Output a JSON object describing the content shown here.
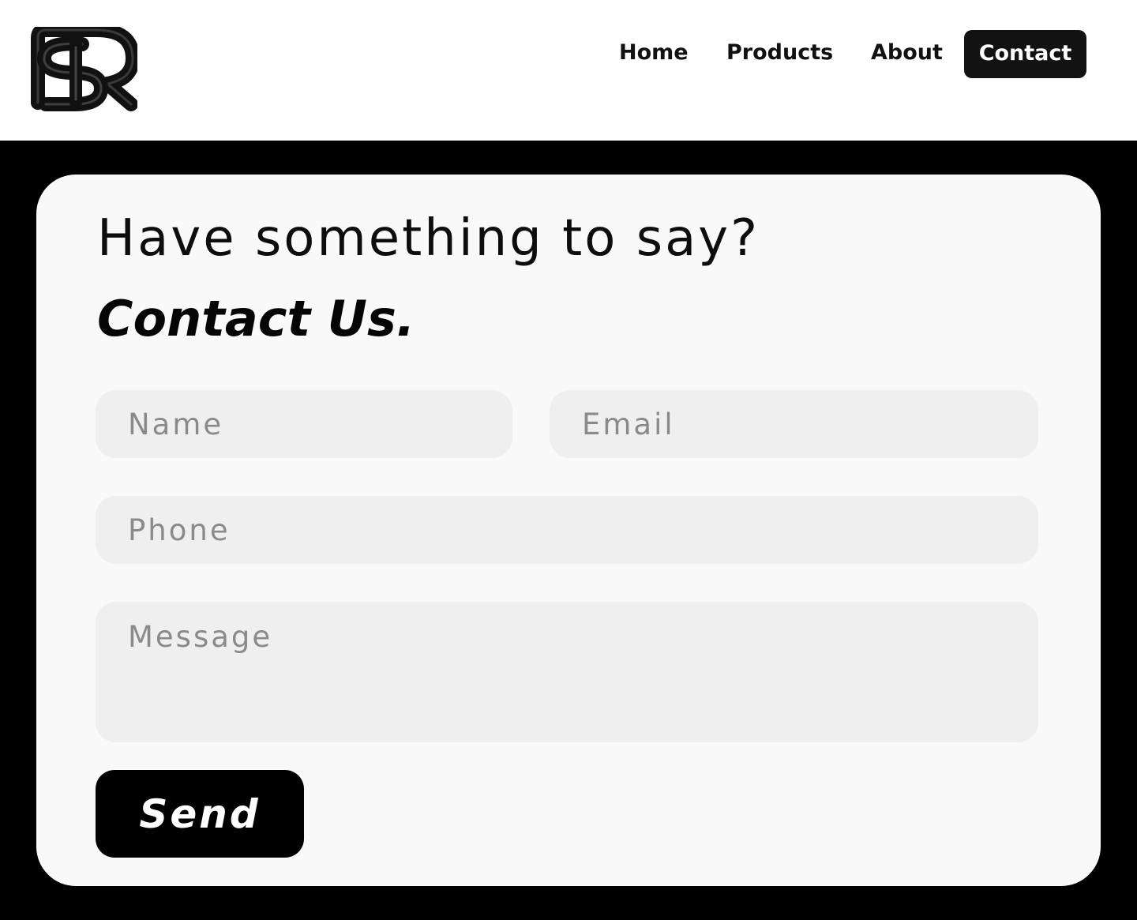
{
  "header": {
    "logo_icon": "sr-monogram-logo-icon",
    "nav": {
      "home_label": "Home",
      "products_label": "Products",
      "about_label": "About",
      "contact_label": "Contact",
      "active": "Contact"
    }
  },
  "main": {
    "heading_line1": "Have something to say?",
    "heading_line2": "Contact Us.",
    "form": {
      "name_placeholder": "Name",
      "email_placeholder": "Email",
      "phone_placeholder": "Phone",
      "message_placeholder": "Message",
      "send_label": "Send"
    }
  },
  "colors": {
    "background": "#000000",
    "header_background": "#ffffff",
    "card_background": "#f9f9f9",
    "field_background": "#efefef",
    "placeholder_text": "#8a8a8a",
    "button_background": "#000000",
    "button_text": "#ffffff"
  }
}
